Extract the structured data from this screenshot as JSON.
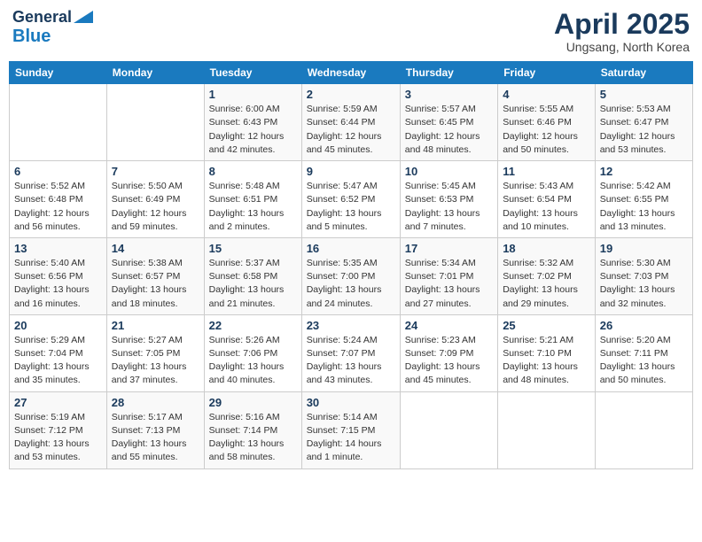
{
  "header": {
    "logo_line1": "General",
    "logo_line2": "Blue",
    "month": "April 2025",
    "location": "Ungsang, North Korea"
  },
  "days_of_week": [
    "Sunday",
    "Monday",
    "Tuesday",
    "Wednesday",
    "Thursday",
    "Friday",
    "Saturday"
  ],
  "weeks": [
    [
      {
        "day": "",
        "detail": ""
      },
      {
        "day": "",
        "detail": ""
      },
      {
        "day": "1",
        "detail": "Sunrise: 6:00 AM\nSunset: 6:43 PM\nDaylight: 12 hours\nand 42 minutes."
      },
      {
        "day": "2",
        "detail": "Sunrise: 5:59 AM\nSunset: 6:44 PM\nDaylight: 12 hours\nand 45 minutes."
      },
      {
        "day": "3",
        "detail": "Sunrise: 5:57 AM\nSunset: 6:45 PM\nDaylight: 12 hours\nand 48 minutes."
      },
      {
        "day": "4",
        "detail": "Sunrise: 5:55 AM\nSunset: 6:46 PM\nDaylight: 12 hours\nand 50 minutes."
      },
      {
        "day": "5",
        "detail": "Sunrise: 5:53 AM\nSunset: 6:47 PM\nDaylight: 12 hours\nand 53 minutes."
      }
    ],
    [
      {
        "day": "6",
        "detail": "Sunrise: 5:52 AM\nSunset: 6:48 PM\nDaylight: 12 hours\nand 56 minutes."
      },
      {
        "day": "7",
        "detail": "Sunrise: 5:50 AM\nSunset: 6:49 PM\nDaylight: 12 hours\nand 59 minutes."
      },
      {
        "day": "8",
        "detail": "Sunrise: 5:48 AM\nSunset: 6:51 PM\nDaylight: 13 hours\nand 2 minutes."
      },
      {
        "day": "9",
        "detail": "Sunrise: 5:47 AM\nSunset: 6:52 PM\nDaylight: 13 hours\nand 5 minutes."
      },
      {
        "day": "10",
        "detail": "Sunrise: 5:45 AM\nSunset: 6:53 PM\nDaylight: 13 hours\nand 7 minutes."
      },
      {
        "day": "11",
        "detail": "Sunrise: 5:43 AM\nSunset: 6:54 PM\nDaylight: 13 hours\nand 10 minutes."
      },
      {
        "day": "12",
        "detail": "Sunrise: 5:42 AM\nSunset: 6:55 PM\nDaylight: 13 hours\nand 13 minutes."
      }
    ],
    [
      {
        "day": "13",
        "detail": "Sunrise: 5:40 AM\nSunset: 6:56 PM\nDaylight: 13 hours\nand 16 minutes."
      },
      {
        "day": "14",
        "detail": "Sunrise: 5:38 AM\nSunset: 6:57 PM\nDaylight: 13 hours\nand 18 minutes."
      },
      {
        "day": "15",
        "detail": "Sunrise: 5:37 AM\nSunset: 6:58 PM\nDaylight: 13 hours\nand 21 minutes."
      },
      {
        "day": "16",
        "detail": "Sunrise: 5:35 AM\nSunset: 7:00 PM\nDaylight: 13 hours\nand 24 minutes."
      },
      {
        "day": "17",
        "detail": "Sunrise: 5:34 AM\nSunset: 7:01 PM\nDaylight: 13 hours\nand 27 minutes."
      },
      {
        "day": "18",
        "detail": "Sunrise: 5:32 AM\nSunset: 7:02 PM\nDaylight: 13 hours\nand 29 minutes."
      },
      {
        "day": "19",
        "detail": "Sunrise: 5:30 AM\nSunset: 7:03 PM\nDaylight: 13 hours\nand 32 minutes."
      }
    ],
    [
      {
        "day": "20",
        "detail": "Sunrise: 5:29 AM\nSunset: 7:04 PM\nDaylight: 13 hours\nand 35 minutes."
      },
      {
        "day": "21",
        "detail": "Sunrise: 5:27 AM\nSunset: 7:05 PM\nDaylight: 13 hours\nand 37 minutes."
      },
      {
        "day": "22",
        "detail": "Sunrise: 5:26 AM\nSunset: 7:06 PM\nDaylight: 13 hours\nand 40 minutes."
      },
      {
        "day": "23",
        "detail": "Sunrise: 5:24 AM\nSunset: 7:07 PM\nDaylight: 13 hours\nand 43 minutes."
      },
      {
        "day": "24",
        "detail": "Sunrise: 5:23 AM\nSunset: 7:09 PM\nDaylight: 13 hours\nand 45 minutes."
      },
      {
        "day": "25",
        "detail": "Sunrise: 5:21 AM\nSunset: 7:10 PM\nDaylight: 13 hours\nand 48 minutes."
      },
      {
        "day": "26",
        "detail": "Sunrise: 5:20 AM\nSunset: 7:11 PM\nDaylight: 13 hours\nand 50 minutes."
      }
    ],
    [
      {
        "day": "27",
        "detail": "Sunrise: 5:19 AM\nSunset: 7:12 PM\nDaylight: 13 hours\nand 53 minutes."
      },
      {
        "day": "28",
        "detail": "Sunrise: 5:17 AM\nSunset: 7:13 PM\nDaylight: 13 hours\nand 55 minutes."
      },
      {
        "day": "29",
        "detail": "Sunrise: 5:16 AM\nSunset: 7:14 PM\nDaylight: 13 hours\nand 58 minutes."
      },
      {
        "day": "30",
        "detail": "Sunrise: 5:14 AM\nSunset: 7:15 PM\nDaylight: 14 hours\nand 1 minute."
      },
      {
        "day": "",
        "detail": ""
      },
      {
        "day": "",
        "detail": ""
      },
      {
        "day": "",
        "detail": ""
      }
    ]
  ]
}
